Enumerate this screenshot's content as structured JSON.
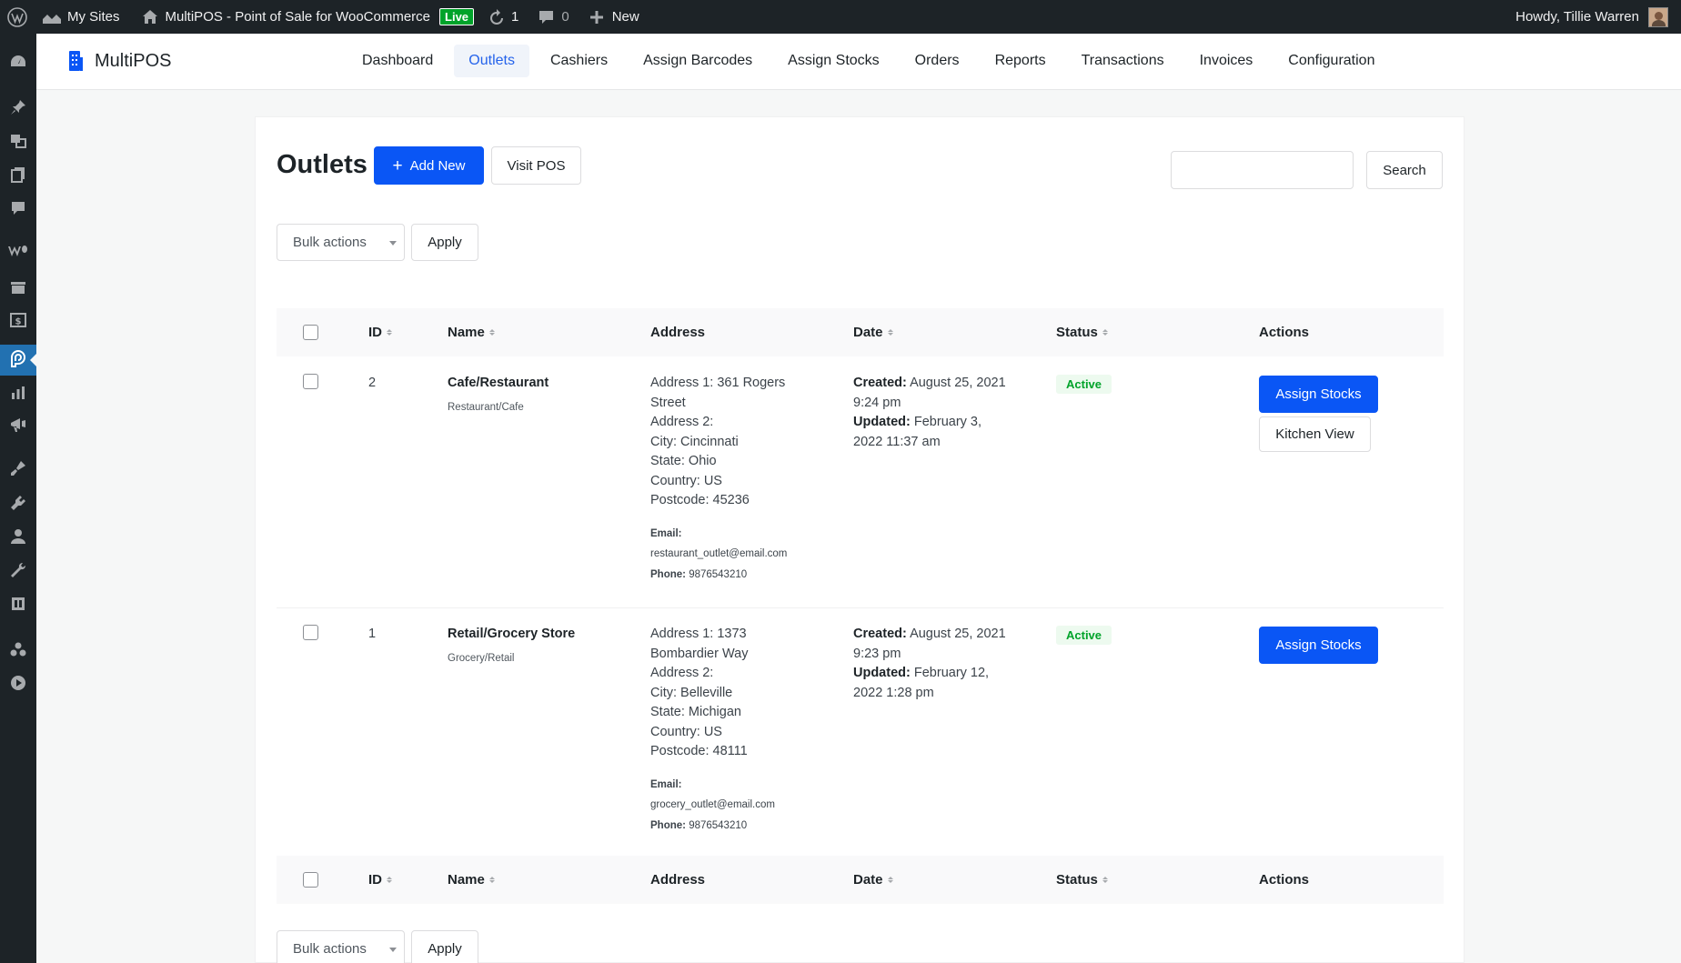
{
  "adminbar": {
    "my_sites": "My Sites",
    "site_name": "MultiPOS - Point of Sale for WooCommerce",
    "live_badge": "Live",
    "updates_count": "1",
    "comments_count": "0",
    "new_label": "New",
    "howdy": "Howdy, Tillie Warren"
  },
  "brand": {
    "name": "MultiPOS",
    "accent": "#0a56f5"
  },
  "nav": {
    "items": [
      {
        "label": "Dashboard"
      },
      {
        "label": "Outlets"
      },
      {
        "label": "Cashiers"
      },
      {
        "label": "Assign Barcodes"
      },
      {
        "label": "Assign Stocks"
      },
      {
        "label": "Orders"
      },
      {
        "label": "Reports"
      },
      {
        "label": "Transactions"
      },
      {
        "label": "Invoices"
      },
      {
        "label": "Configuration"
      }
    ],
    "active": "Outlets"
  },
  "page": {
    "title": "Outlets",
    "add_new": "Add New",
    "visit_pos": "Visit POS",
    "search_button": "Search",
    "search_value": "",
    "bulk_actions": "Bulk actions",
    "apply": "Apply"
  },
  "table": {
    "columns": [
      "ID",
      "Name",
      "Address",
      "Date",
      "Status",
      "Actions"
    ],
    "rows": [
      {
        "id": "2",
        "name": "Cafe/Restaurant",
        "type": "Restaurant/Cafe",
        "address_lines": [
          "Address 1: 361 Rogers",
          "Street",
          "Address 2:",
          "City: Cincinnati",
          "State: Ohio",
          "Country: US",
          "Postcode: 45236"
        ],
        "email_label": "Email:",
        "email": "restaurant_outlet@email.com",
        "phone_label": "Phone:",
        "phone": "9876543210",
        "created_label": "Created:",
        "created_1": "August 25, 2021",
        "created_2": "9:24 pm",
        "updated_label": "Updated:",
        "updated_1": "February 3,",
        "updated_2": "2022 11:37 am",
        "status": "Active",
        "action_primary": "Assign Stocks",
        "action_secondary": "Kitchen View"
      },
      {
        "id": "1",
        "name": "Retail/Grocery Store",
        "type": "Grocery/Retail",
        "address_lines": [
          "Address 1: 1373",
          "Bombardier Way",
          "Address 2:",
          "City: Belleville",
          "State: Michigan",
          "Country: US",
          "Postcode: 48111"
        ],
        "email_label": "Email:",
        "email": "grocery_outlet@email.com",
        "phone_label": "Phone:",
        "phone": "9876543210",
        "created_label": "Created:",
        "created_1": "August 25, 2021",
        "created_2": "9:23 pm",
        "updated_label": "Updated:",
        "updated_1": "February 12,",
        "updated_2": "2022 1:28 pm",
        "status": "Active",
        "action_primary": "Assign Stocks"
      }
    ]
  }
}
